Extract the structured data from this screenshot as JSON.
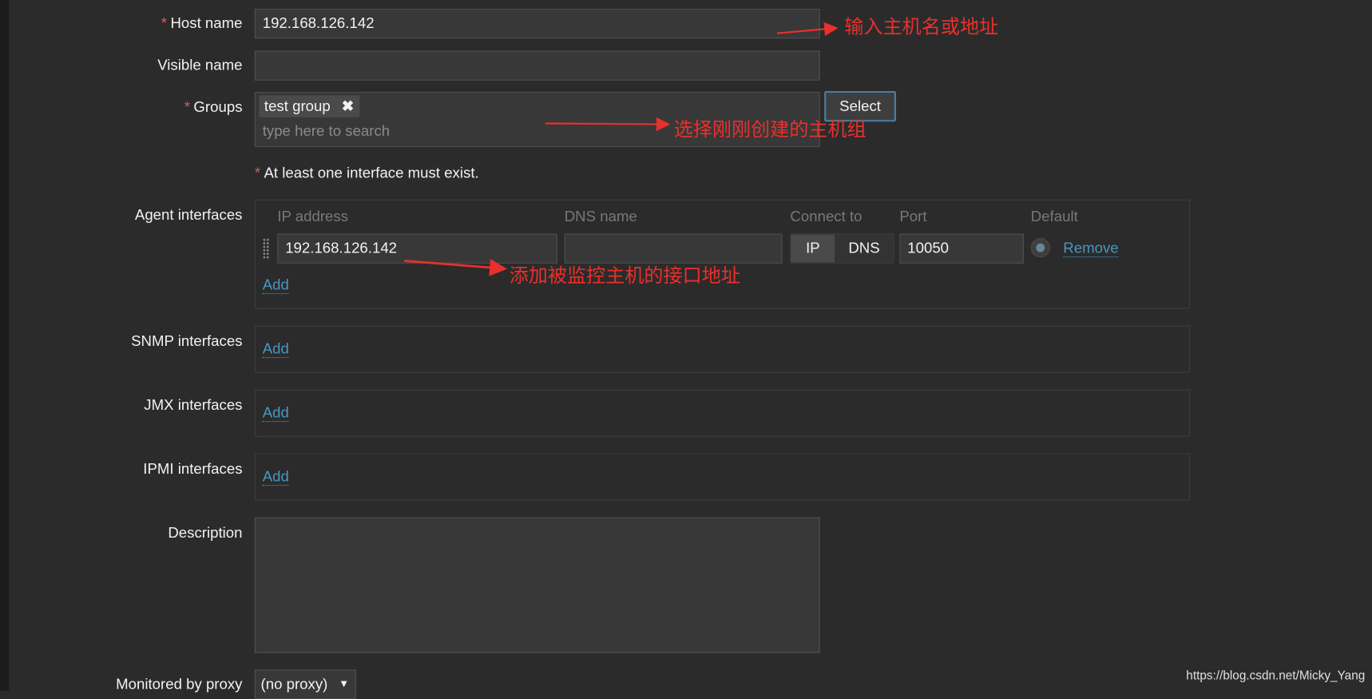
{
  "form": {
    "host_name": {
      "label": "Host name",
      "value": "192.168.126.142",
      "required": true
    },
    "visible_name": {
      "label": "Visible name",
      "value": ""
    },
    "groups": {
      "label": "Groups",
      "required": true,
      "tags": [
        "test group"
      ],
      "placeholder": "type here to search",
      "select_label": "Select"
    },
    "interface_note": "At least one interface must exist.",
    "agent_interfaces": {
      "label": "Agent interfaces",
      "columns": [
        "IP address",
        "DNS name",
        "Connect to",
        "Port",
        "Default"
      ],
      "row": {
        "ip": "192.168.126.142",
        "dns": "",
        "connect_options": [
          "IP",
          "DNS"
        ],
        "connect_selected": "IP",
        "port": "10050",
        "default": true,
        "remove_label": "Remove"
      },
      "add_label": "Add"
    },
    "snmp_interfaces": {
      "label": "SNMP interfaces",
      "add_label": "Add"
    },
    "jmx_interfaces": {
      "label": "JMX interfaces",
      "add_label": "Add"
    },
    "ipmi_interfaces": {
      "label": "IPMI interfaces",
      "add_label": "Add"
    },
    "description": {
      "label": "Description",
      "value": ""
    },
    "proxy": {
      "label": "Monitored by proxy",
      "value": "(no proxy)"
    }
  },
  "annotations": [
    "输入主机名或地址",
    "选择刚刚创建的主机组",
    "添加被监控主机的接口地址"
  ],
  "watermark": "https://blog.csdn.net/Micky_Yang",
  "colors": {
    "background": "#2b2b2b",
    "input": "#383838",
    "link": "#4796c4",
    "required": "#e45959",
    "annotation": "#e8302c"
  }
}
